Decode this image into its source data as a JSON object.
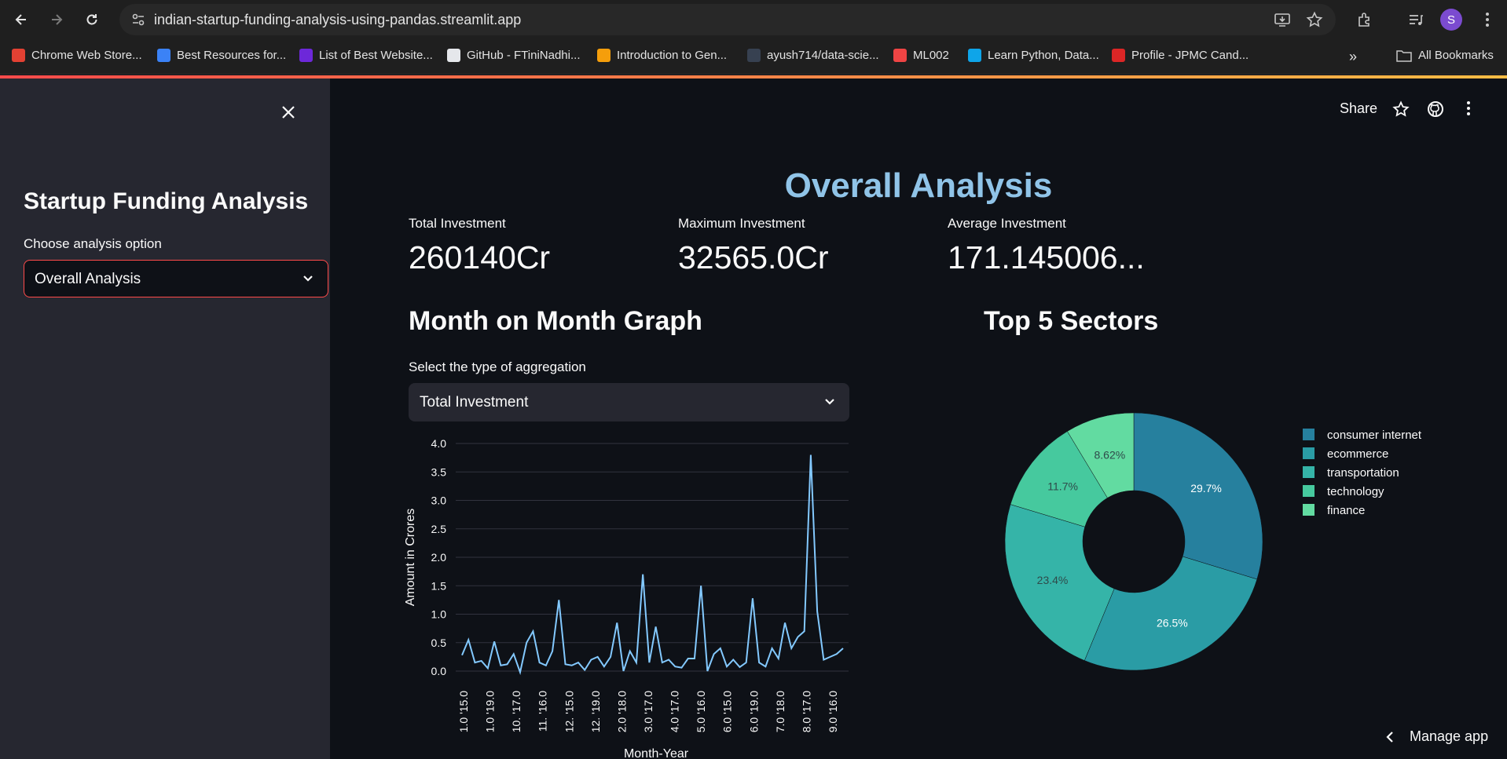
{
  "browser": {
    "url": "indian-startup-funding-analysis-using-pandas.streamlit.app",
    "avatar_initial": "S",
    "bookmarks": [
      {
        "label": "Chrome Web Store...",
        "color": "#e34133"
      },
      {
        "label": "Best Resources for...",
        "color": "#3b82f6"
      },
      {
        "label": "List of Best Website...",
        "color": "#6d28d9"
      },
      {
        "label": "GitHub - FTiniNadhi...",
        "color": "#e5e7eb"
      },
      {
        "label": "Introduction to Gen...",
        "color": "#f59e0b"
      },
      {
        "label": "ayush714/data-scie...",
        "color": "#374151"
      },
      {
        "label": "ML002",
        "color": "#ef4444"
      },
      {
        "label": "Learn Python, Data...",
        "color": "#0ea5e9"
      },
      {
        "label": "Profile - JPMC Cand...",
        "color": "#dc2626"
      }
    ],
    "all_bookmarks_label": "All Bookmarks"
  },
  "sidebar": {
    "title": "Startup Funding Analysis",
    "select_label": "Choose analysis option",
    "select_value": "Overall Analysis"
  },
  "toolbar": {
    "share_label": "Share"
  },
  "main": {
    "title": "Overall Analysis",
    "metrics": [
      {
        "label": "Total Investment",
        "value": "260140Cr"
      },
      {
        "label": "Maximum Investment",
        "value": "32565.0Cr"
      },
      {
        "label": "Average Investment",
        "value": "171.145006..."
      }
    ],
    "mom_title": "Month on Month Graph",
    "agg_label": "Select the type of aggregation",
    "agg_value": "Total Investment",
    "sectors_title": "Top 5 Sectors",
    "manage_app_label": "Manage app"
  },
  "chart_data": [
    {
      "type": "line",
      "xlabel": "Month-Year",
      "ylabel": "Amount in Crores",
      "ylim": [
        0,
        4.0
      ],
      "y_ticks": [
        "0.0",
        "0.5",
        "1.0",
        "1.5",
        "2.0",
        "2.5",
        "3.0",
        "3.5",
        "4.0"
      ],
      "x_tick_labels": [
        "1.0 '15.0",
        "1.0 '19.0",
        "10. '17.0",
        "11. '16.0",
        "12. '15.0",
        "12. '19.0",
        "2.0 '18.0",
        "3.0 '17.0",
        "4.0 '17.0",
        "5.0 '16.0",
        "6.0 '15.0",
        "6.0 '19.0",
        "7.0 '18.0",
        "8.0 '17.0",
        "9.0 '16.0"
      ],
      "line_color": "#83c9ff",
      "values": [
        0.28,
        0.55,
        0.15,
        0.18,
        0.05,
        0.52,
        0.1,
        0.12,
        0.3,
        -0.02,
        0.5,
        0.7,
        0.15,
        0.1,
        0.35,
        1.25,
        0.12,
        0.1,
        0.15,
        0.02,
        0.2,
        0.25,
        0.08,
        0.25,
        0.85,
        0.0,
        0.35,
        0.15,
        1.7,
        0.15,
        0.78,
        0.15,
        0.2,
        0.08,
        0.06,
        0.22,
        0.22,
        1.5,
        0.0,
        0.3,
        0.4,
        0.08,
        0.2,
        0.07,
        0.15,
        1.28,
        0.15,
        0.08,
        0.4,
        0.22,
        0.85,
        0.4,
        0.6,
        0.7,
        3.8,
        1.05,
        0.2,
        0.25,
        0.3,
        0.4
      ],
      "grid": true
    },
    {
      "type": "pie",
      "donut": true,
      "slices": [
        {
          "label": "consumer internet",
          "percent": 29.7,
          "display": "29.7%",
          "color": "#26809e"
        },
        {
          "label": "ecommerce",
          "percent": 26.5,
          "display": "26.5%",
          "color": "#2a9ca5"
        },
        {
          "label": "transportation",
          "percent": 23.4,
          "display": "23.4%",
          "color": "#35b4a8"
        },
        {
          "label": "technology",
          "percent": 11.7,
          "display": "11.7%",
          "color": "#46c99e"
        },
        {
          "label": "finance",
          "percent": 8.62,
          "display": "8.62%",
          "color": "#62dba1"
        }
      ],
      "legend_position": "right"
    }
  ]
}
